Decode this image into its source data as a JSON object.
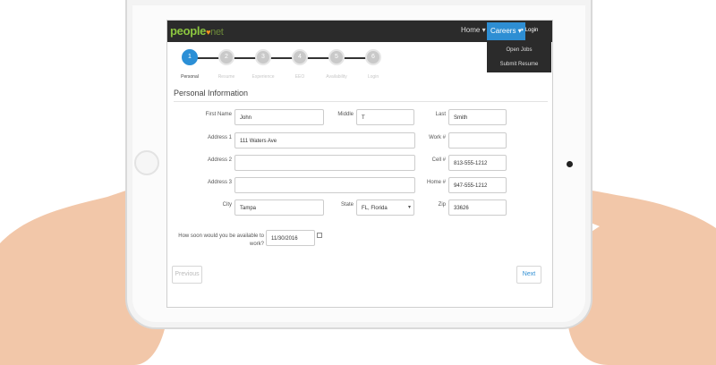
{
  "logo": {
    "part1": "people",
    "part2": "net"
  },
  "nav": {
    "home": "Home",
    "careers": "Careers",
    "login": "Login",
    "dropdown": [
      "Open Jobs",
      "Submit Resume"
    ]
  },
  "steps": [
    {
      "num": "1",
      "label": "Personal",
      "active": true
    },
    {
      "num": "2",
      "label": "Resume",
      "active": false
    },
    {
      "num": "3",
      "label": "Experience",
      "active": false
    },
    {
      "num": "4",
      "label": "EEO",
      "active": false
    },
    {
      "num": "5",
      "label": "Availability",
      "active": false
    },
    {
      "num": "6",
      "label": "Login",
      "active": false
    }
  ],
  "form": {
    "title": "Personal Information",
    "first_name": {
      "label": "First Name",
      "value": "John"
    },
    "middle": {
      "label": "Middle",
      "value": "T"
    },
    "last": {
      "label": "Last",
      "value": "Smith"
    },
    "address1": {
      "label": "Address 1",
      "value": "111 Waters Ave"
    },
    "address2": {
      "label": "Address 2",
      "value": ""
    },
    "address3": {
      "label": "Address 3",
      "value": ""
    },
    "work": {
      "label": "Work #",
      "value": ""
    },
    "cell": {
      "label": "Cell #",
      "value": "813-555-1212"
    },
    "home": {
      "label": "Home #",
      "value": "947-555-1212"
    },
    "city": {
      "label": "City",
      "value": "Tampa"
    },
    "state": {
      "label": "State",
      "value": "FL, Florida"
    },
    "zip": {
      "label": "Zip",
      "value": "33626"
    },
    "availability": {
      "label": "How soon would you be available to work?",
      "value": "11/30/2016"
    }
  },
  "buttons": {
    "previous": "Previous",
    "next": "Next"
  },
  "colors": {
    "accent": "#2e8ed3",
    "navbar": "#2b2b2b",
    "logo_green": "#8cc63f"
  }
}
